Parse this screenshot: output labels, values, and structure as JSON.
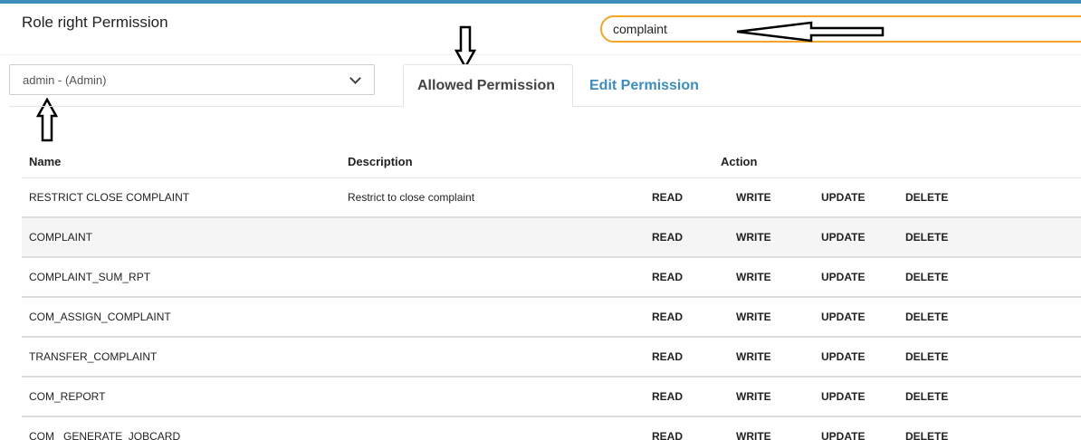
{
  "header": {
    "title": "Role right Permission",
    "search_value": "complaint"
  },
  "role_select": {
    "selected": "admin - (Admin)"
  },
  "tabs": [
    {
      "label": "Allowed Permission",
      "active": true
    },
    {
      "label": "Edit Permission",
      "active": false
    }
  ],
  "table": {
    "headers": {
      "name": "Name",
      "description": "Description",
      "action": "Action"
    },
    "action_labels": {
      "read": "READ",
      "write": "WRITE",
      "update": "UPDATE",
      "delete": "DELETE"
    },
    "rows": [
      {
        "name": "RESTRICT CLOSE COMPLAINT",
        "description": "Restrict to close complaint"
      },
      {
        "name": "COMPLAINT",
        "description": ""
      },
      {
        "name": "COMPLAINT_SUM_RPT",
        "description": ""
      },
      {
        "name": "COM_ASSIGN_COMPLAINT",
        "description": ""
      },
      {
        "name": "TRANSFER_COMPLAINT",
        "description": ""
      },
      {
        "name": "COM_REPORT",
        "description": ""
      },
      {
        "name": "COM_ GENERATE_JOBCARD",
        "description": ""
      }
    ]
  },
  "colors": {
    "accent": "#3c8dbc",
    "search_border": "#f5a623"
  }
}
